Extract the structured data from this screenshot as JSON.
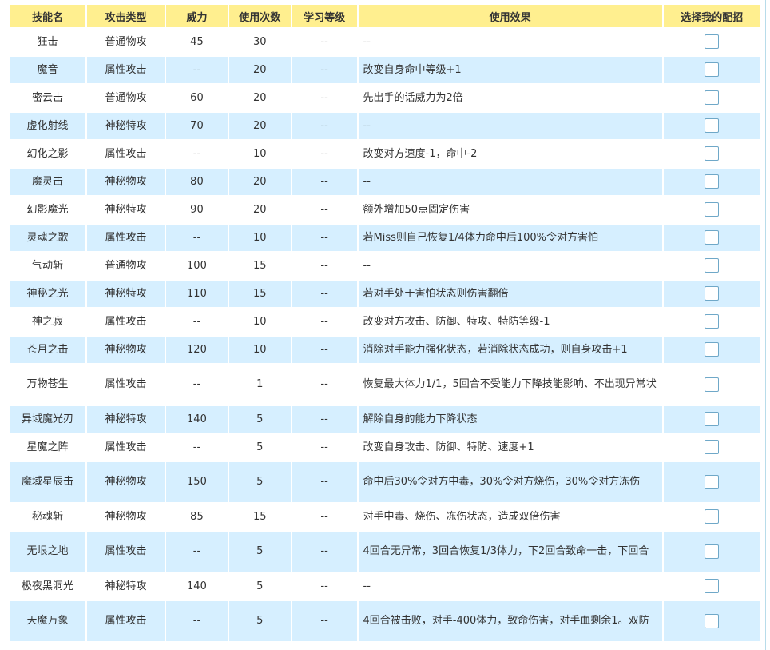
{
  "headers": {
    "name": "技能名",
    "type": "攻击类型",
    "power": "威力",
    "pp": "使用次数",
    "level": "学习等级",
    "effect": "使用效果",
    "select": "选择我的配招"
  },
  "rows": [
    {
      "name": "狂击",
      "type": "普通物攻",
      "power": "45",
      "pp": "30",
      "level": "--",
      "effect": "--"
    },
    {
      "name": "魔音",
      "type": "属性攻击",
      "power": "--",
      "pp": "20",
      "level": "--",
      "effect": "改变自身命中等级+1"
    },
    {
      "name": "密云击",
      "type": "普通物攻",
      "power": "60",
      "pp": "20",
      "level": "--",
      "effect": "先出手的话威力为2倍"
    },
    {
      "name": "虚化射线",
      "type": "神秘特攻",
      "power": "70",
      "pp": "20",
      "level": "--",
      "effect": "--"
    },
    {
      "name": "幻化之影",
      "type": "属性攻击",
      "power": "--",
      "pp": "10",
      "level": "--",
      "effect": "改变对方速度-1，命中-2"
    },
    {
      "name": "魔灵击",
      "type": "神秘物攻",
      "power": "80",
      "pp": "20",
      "level": "--",
      "effect": "--"
    },
    {
      "name": "幻影魔光",
      "type": "神秘特攻",
      "power": "90",
      "pp": "20",
      "level": "--",
      "effect": "额外增加50点固定伤害"
    },
    {
      "name": "灵魂之歌",
      "type": "属性攻击",
      "power": "--",
      "pp": "10",
      "level": "--",
      "effect": "若Miss则自己恢复1/4体力命中后100%令对方害怕"
    },
    {
      "name": "气动斩",
      "type": "普通物攻",
      "power": "100",
      "pp": "15",
      "level": "--",
      "effect": "--"
    },
    {
      "name": "神秘之光",
      "type": "神秘特攻",
      "power": "110",
      "pp": "15",
      "level": "--",
      "effect": "若对手处于害怕状态则伤害翻倍"
    },
    {
      "name": "神之寂",
      "type": "属性攻击",
      "power": "--",
      "pp": "10",
      "level": "--",
      "effect": "改变对方攻击、防御、特攻、特防等级-1"
    },
    {
      "name": "苍月之击",
      "type": "神秘物攻",
      "power": "120",
      "pp": "10",
      "level": "--",
      "effect": "消除对手能力强化状态，若消除状态成功，则自身攻击+1"
    },
    {
      "name": "万物苍生",
      "type": "属性攻击",
      "power": "--",
      "pp": "1",
      "level": "--",
      "effect": "恢复最大体力1/1，5回合不受能力下降技能影响、不出现异常状"
    },
    {
      "name": "异域魔光刃",
      "type": "神秘特攻",
      "power": "140",
      "pp": "5",
      "level": "--",
      "effect": "解除自身的能力下降状态"
    },
    {
      "name": "星魔之阵",
      "type": "属性攻击",
      "power": "--",
      "pp": "5",
      "level": "--",
      "effect": "改变自身攻击、防御、特防、速度+1"
    },
    {
      "name": "魔域星辰击",
      "type": "神秘物攻",
      "power": "150",
      "pp": "5",
      "level": "--",
      "effect": "命中后30%令对方中毒，30%令对方烧伤，30%令对方冻伤"
    },
    {
      "name": "秘魂斩",
      "type": "神秘物攻",
      "power": "85",
      "pp": "15",
      "level": "--",
      "effect": "对手中毒、烧伤、冻伤状态，造成双倍伤害"
    },
    {
      "name": "无垠之地",
      "type": "属性攻击",
      "power": "--",
      "pp": "5",
      "level": "--",
      "effect": "4回合无异常，3回合恢复1/3体力，下2回合致命一击，下回合"
    },
    {
      "name": "极夜黑洞光",
      "type": "神秘特攻",
      "power": "140",
      "pp": "5",
      "level": "--",
      "effect": "--"
    },
    {
      "name": "天魔万象",
      "type": "属性攻击",
      "power": "--",
      "pp": "5",
      "level": "--",
      "effect": "4回合被击败，对手-400体力，致命伤害，对手血剩余1。双防"
    }
  ],
  "colors": {
    "header_bg": "#ffef8f",
    "row_alt_bg": "#d6efff",
    "row_bg": "#ffffff"
  }
}
